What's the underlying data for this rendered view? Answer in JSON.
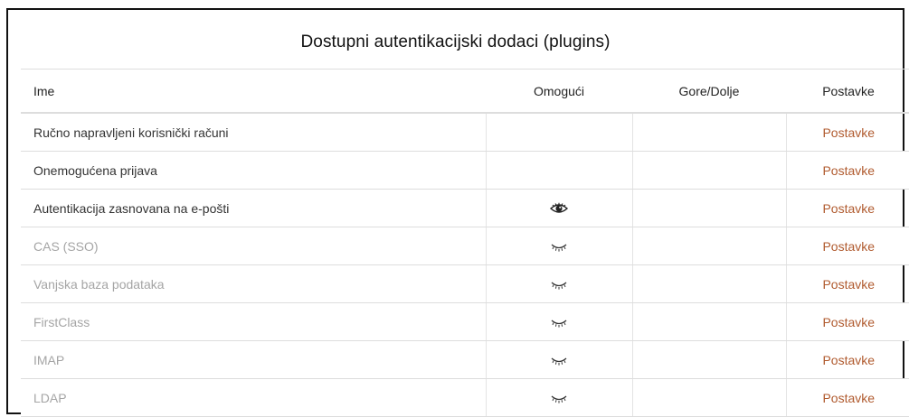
{
  "title": "Dostupni autentikacijski dodaci (plugins)",
  "columns": {
    "name": "Ime",
    "enable": "Omogući",
    "updown": "Gore/Dolje",
    "settings": "Postavke"
  },
  "rows": [
    {
      "name": "Ručno napravljeni korisnički računi",
      "enable_icon": "",
      "settings": "Postavke",
      "state": "system"
    },
    {
      "name": "Onemogućena prijava",
      "enable_icon": "",
      "settings": "Postavke",
      "state": "system"
    },
    {
      "name": "Autentikacija zasnovana na e-pošti",
      "enable_icon": "eye-open-icon",
      "settings": "Postavke",
      "state": "enabled"
    },
    {
      "name": "CAS (SSO)",
      "enable_icon": "eye-closed-icon",
      "settings": "Postavke",
      "state": "disabled"
    },
    {
      "name": "Vanjska baza podataka",
      "enable_icon": "eye-closed-icon",
      "settings": "Postavke",
      "state": "disabled"
    },
    {
      "name": "FirstClass",
      "enable_icon": "eye-closed-icon",
      "settings": "Postavke",
      "state": "disabled"
    },
    {
      "name": "IMAP",
      "enable_icon": "eye-closed-icon",
      "settings": "Postavke",
      "state": "disabled"
    },
    {
      "name": "LDAP",
      "enable_icon": "eye-closed-icon",
      "settings": "Postavke",
      "state": "disabled"
    }
  ],
  "colors": {
    "link": "#b05a2e",
    "disabled_text": "#a5a5a5",
    "border": "#dddddd"
  }
}
